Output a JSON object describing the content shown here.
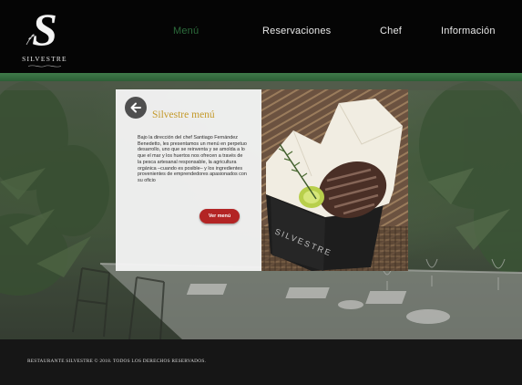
{
  "brand": {
    "name": "SILVESTRE",
    "monogram": "S"
  },
  "nav": {
    "items": [
      {
        "label": "Menú",
        "active": true
      },
      {
        "label": "Reservaciones",
        "active": false
      },
      {
        "label": "Chef",
        "active": false
      },
      {
        "label": "Información",
        "active": false
      }
    ]
  },
  "card": {
    "back_icon": "arrow-left-icon",
    "title": "Silvestre menú",
    "body": "Bajo la dirección del chef Santiago Fernández Benedetto, les presentamos un menú en perpetuo desarrollo, uno que se reinventa y se amolda a lo que el mar y los huertos nos ofrecen a través de la pesca artesanal responsable, la agricultura orgánica –cuando es posible– y los ingredientes provenientes de emprendedores apasionados con su oficio",
    "cta_label": "Ver menú",
    "photo_box_text": "SILVESTRE"
  },
  "footer": {
    "copyright": "RESTAURANTE SILVESTRE © 2018. TODOS LOS DERECHOS RESERVADOS."
  },
  "colors": {
    "header_bg": "#050505",
    "nav_active": "#2c6b3b",
    "accent_band": "#3f7a49",
    "title_gold": "#c49a2c",
    "cta_red": "#b32424",
    "footer_bg": "#161616"
  }
}
